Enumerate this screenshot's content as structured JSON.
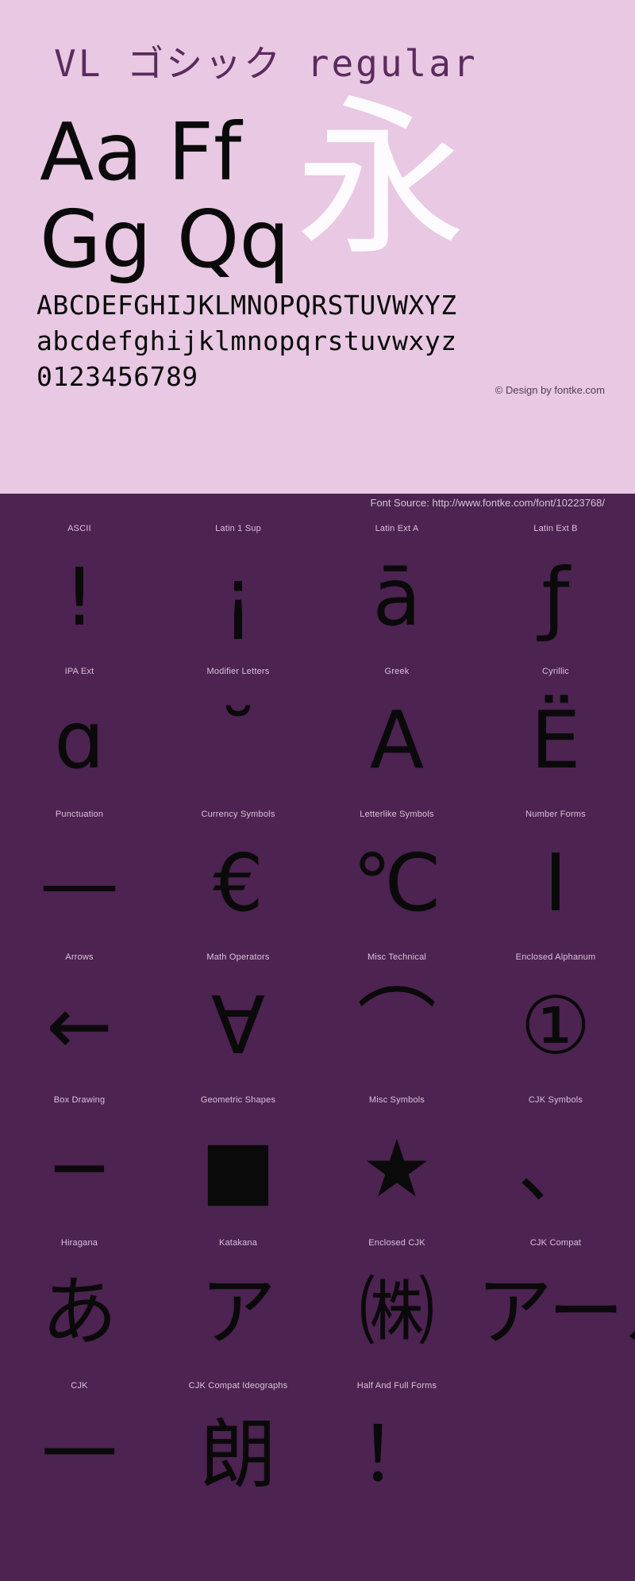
{
  "page": {
    "background_pink": "#e8c8e2",
    "background_purple": "#4d2351",
    "glyph_color": "#0a0a0a",
    "title_color": "#5b2b5e",
    "label_color": "#d9c4d9"
  },
  "header": {
    "title": "VL ゴシック regular",
    "big_sample_row1": "Aa  Ff",
    "big_sample_row2": "Gg  Qq",
    "cjk_sample": "永",
    "uppercase_row": "ABCDEFGHIJKLMNOPQRSTUVWXYZ",
    "lowercase_row": "abcdefghijklmnopqrstuvwxyz",
    "digits_row": "0123456789",
    "credit": "© Design by fontke.com"
  },
  "source_band": {
    "text": "Font Source: http://www.fontke.com/font/10223768/"
  },
  "grid": {
    "rows": [
      {
        "cells": [
          {
            "label": "ASCII",
            "glyph": "!"
          },
          {
            "label": "Latin 1 Sup",
            "glyph": "¡"
          },
          {
            "label": "Latin Ext A",
            "glyph": "ā"
          },
          {
            "label": "Latin Ext B",
            "glyph": "ƒ"
          }
        ]
      },
      {
        "cells": [
          {
            "label": "IPA Ext",
            "glyph": "ɑ"
          },
          {
            "label": "Modifier Letters",
            "glyph": "˘"
          },
          {
            "label": "Greek",
            "glyph": "Α"
          },
          {
            "label": "Cyrillic",
            "glyph": "Ё"
          }
        ]
      },
      {
        "cells": [
          {
            "label": "Punctuation",
            "glyph": "—"
          },
          {
            "label": "Currency Symbols",
            "glyph": "€"
          },
          {
            "label": "Letterlike Symbols",
            "glyph": "℃"
          },
          {
            "label": "Number Forms",
            "glyph": "Ⅰ"
          }
        ]
      },
      {
        "cells": [
          {
            "label": "Arrows",
            "glyph": "←"
          },
          {
            "label": "Math Operators",
            "glyph": "∀"
          },
          {
            "label": "Misc Technical",
            "glyph": "⌒"
          },
          {
            "label": "Enclosed Alphanum",
            "glyph": "①"
          }
        ]
      },
      {
        "cells": [
          {
            "label": "Box Drawing",
            "glyph": "─"
          },
          {
            "label": "Geometric Shapes",
            "glyph": "■"
          },
          {
            "label": "Misc Symbols",
            "glyph": "★"
          },
          {
            "label": "CJK Symbols",
            "glyph": "、"
          }
        ]
      },
      {
        "cells": [
          {
            "label": "Hiragana",
            "glyph": "あ"
          },
          {
            "label": "Katakana",
            "glyph": "ア"
          },
          {
            "label": "Enclosed CJK",
            "glyph": "㈱"
          },
          {
            "label": "CJK Compat",
            "glyph": "アール"
          }
        ]
      },
      {
        "cells": [
          {
            "label": "CJK",
            "glyph": "一"
          },
          {
            "label": "CJK Compat Ideographs",
            "glyph": "朗"
          },
          {
            "label": "Half And Full Forms",
            "glyph": "！"
          },
          {
            "label": "",
            "glyph": ""
          }
        ]
      }
    ]
  }
}
